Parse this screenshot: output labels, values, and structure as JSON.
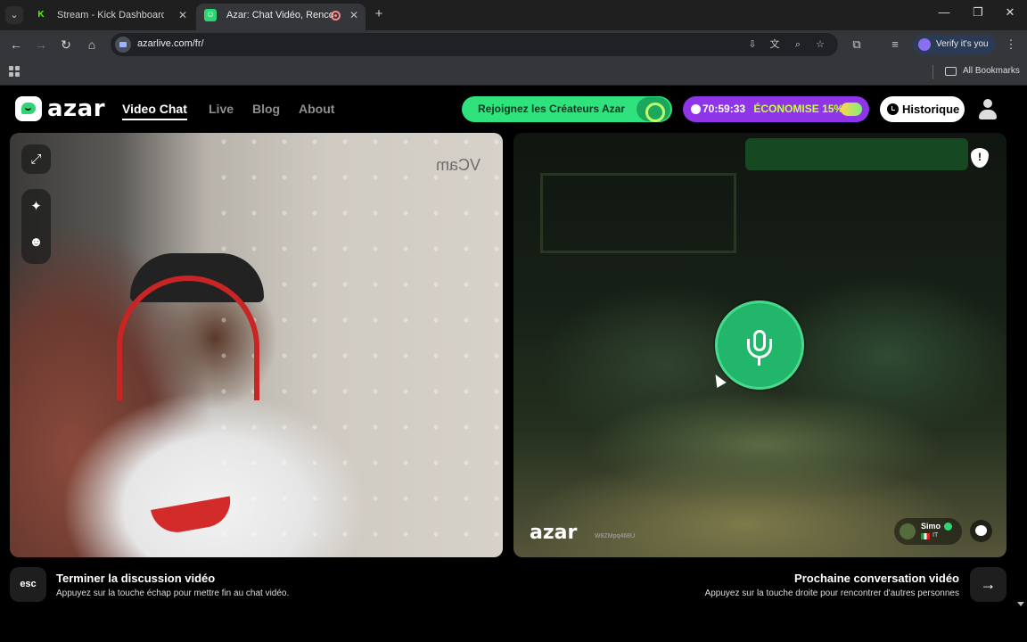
{
  "browser": {
    "tabs": [
      {
        "title": "Stream - Kick Dashboard",
        "favicon": "K",
        "active": false
      },
      {
        "title": "Azar: Chat Vidéo, Rencontr",
        "favicon": "☺",
        "active": true
      }
    ],
    "url": "azarlive.com/fr/",
    "verify_label": "Verify it's you",
    "bookmarks_label": "All Bookmarks"
  },
  "header": {
    "brand": "azar",
    "nav": [
      {
        "label": "Video Chat",
        "active": true
      },
      {
        "label": "Live",
        "active": false
      },
      {
        "label": "Blog",
        "active": false
      },
      {
        "label": "About",
        "active": false
      }
    ],
    "creators_cta": "Rejoignez les Créateurs Azar",
    "promo_timer": "70:59:33",
    "promo_text": "ÉCONOMISE 15%",
    "history_label": "Historique"
  },
  "left_video": {
    "overlay_text": "VCam"
  },
  "right_video": {
    "watermark": "azar",
    "watermark_id": "W8ZMpq468U",
    "peer_name": "Simo",
    "peer_country": "IT"
  },
  "footer": {
    "esc_key": "esc",
    "end_title": "Terminer la discussion vidéo",
    "end_sub": "Appuyez sur la touche échap pour mettre fin au chat vidéo.",
    "next_title": "Prochaine conversation vidéo",
    "next_sub": "Appuyez sur la touche droite pour rencontrer d'autres personnes"
  },
  "colors": {
    "accent_green": "#2fd574",
    "promo_purple": "#8e35e8",
    "background": "#000000"
  }
}
